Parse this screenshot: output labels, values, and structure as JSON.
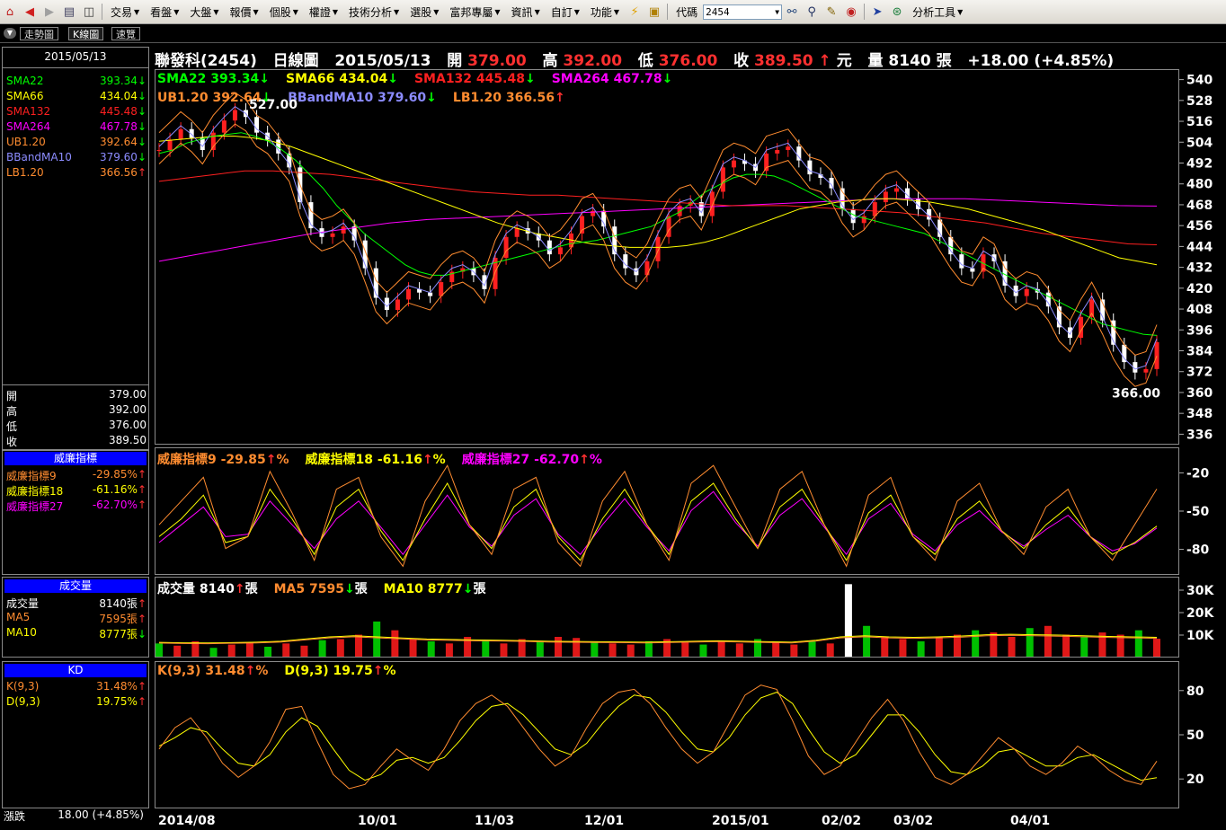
{
  "toolbar": {
    "menus": [
      "交易",
      "看盤",
      "大盤",
      "報價",
      "個股",
      "權證",
      "技術分析",
      "選股",
      "富邦專屬",
      "資訊",
      "自訂",
      "功能"
    ],
    "code_label": "代碼",
    "code_value": "2454",
    "analysis_tools": "分析工具"
  },
  "tabs": [
    "走勢圖",
    "K線圖",
    "速覽"
  ],
  "side": {
    "date": "2015/05/13",
    "indicators": [
      {
        "label": "SMA22",
        "value": "393.34",
        "dir": "down",
        "color": "#00ff00"
      },
      {
        "label": "SMA66",
        "value": "434.04",
        "dir": "down",
        "color": "#ffff00"
      },
      {
        "label": "SMA132",
        "value": "445.48",
        "dir": "down",
        "color": "#ff2020"
      },
      {
        "label": "SMA264",
        "value": "467.78",
        "dir": "down",
        "color": "#ff00ff"
      },
      {
        "label": "UB1.20",
        "value": "392.64",
        "dir": "down",
        "color": "#ff8c30"
      },
      {
        "label": "BBandMA10",
        "value": "379.60",
        "dir": "down",
        "color": "#8c8cff"
      },
      {
        "label": "LB1.20",
        "value": "366.56",
        "dir": "up",
        "color": "#ff8c30"
      }
    ],
    "ohlc": [
      {
        "label": "開",
        "value": "379.00"
      },
      {
        "label": "高",
        "value": "392.00"
      },
      {
        "label": "低",
        "value": "376.00"
      },
      {
        "label": "收",
        "value": "389.50"
      }
    ],
    "williams": {
      "title": "威廉指標",
      "rows": [
        {
          "label": "威廉指標9",
          "value": "-29.85%",
          "dir": "up",
          "color": "#ff8c30"
        },
        {
          "label": "威廉指標18",
          "value": "-61.16%",
          "dir": "up",
          "color": "#ffff00"
        },
        {
          "label": "威廉指標27",
          "value": "-62.70%",
          "dir": "up",
          "color": "#ff00ff"
        }
      ]
    },
    "volume": {
      "title": "成交量",
      "rows": [
        {
          "label": "成交量",
          "value": "8140張",
          "dir": "up",
          "color": "#ffffff"
        },
        {
          "label": "MA5",
          "value": "7595張",
          "dir": "up",
          "color": "#ff8c30"
        },
        {
          "label": "MA10",
          "value": "8777張",
          "dir": "down",
          "color": "#ffff00"
        }
      ]
    },
    "kd": {
      "title": "KD",
      "rows": [
        {
          "label": "K(9,3)",
          "value": "31.48%",
          "dir": "up",
          "color": "#ff8c30"
        },
        {
          "label": "D(9,3)",
          "value": "19.75%",
          "dir": "up",
          "color": "#ffff00"
        }
      ]
    },
    "change_label": "漲跌",
    "change_value": "18.00 (+4.85%)"
  },
  "header": {
    "stock": "聯發科(2454)",
    "chart_kind": "日線圖",
    "date": "2015/05/13",
    "open_label": "開",
    "open": "379.00",
    "high_label": "高",
    "high": "392.00",
    "low_label": "低",
    "low": "376.00",
    "close_label": "收",
    "close": "389.50",
    "unit": "元",
    "volume_label": "量",
    "volume": "8140",
    "volume_unit": "張",
    "change": "+18.00 (+4.85%)"
  },
  "price_legend": [
    {
      "label": "SMA22",
      "value": "393.34",
      "dir": "down",
      "color": "#00ff00"
    },
    {
      "label": "SMA66",
      "value": "434.04",
      "dir": "down",
      "color": "#ffff00"
    },
    {
      "label": "SMA132",
      "value": "445.48",
      "dir": "down",
      "color": "#ff2020"
    },
    {
      "label": "SMA264",
      "value": "467.78",
      "dir": "down",
      "color": "#ff00ff"
    }
  ],
  "band_legend": [
    {
      "label": "UB1.20",
      "value": "392.64",
      "dir": "down",
      "color": "#ff8c30"
    },
    {
      "label": "BBandMA10",
      "value": "379.60",
      "dir": "down",
      "color": "#8c8cff"
    },
    {
      "label": "LB1.20",
      "value": "366.56",
      "dir": "up",
      "color": "#ff8c30"
    }
  ],
  "williams_legend": [
    {
      "label": "威廉指標9",
      "value": "-29.85",
      "dir": "up",
      "unit": "%",
      "color": "#ff8c30"
    },
    {
      "label": "威廉指標18",
      "value": "-61.16",
      "dir": "up",
      "unit": "%",
      "color": "#ffff00"
    },
    {
      "label": "威廉指標27",
      "value": "-62.70",
      "dir": "up",
      "unit": "%",
      "color": "#ff00ff"
    }
  ],
  "volume_legend": [
    {
      "label": "成交量",
      "value": "8140",
      "dir": "up",
      "unit": "張",
      "color": "#ffffff"
    },
    {
      "label": "MA5",
      "value": "7595",
      "dir": "down",
      "unit": "張",
      "color": "#ff8c30"
    },
    {
      "label": "MA10",
      "value": "8777",
      "dir": "down",
      "unit": "張",
      "color": "#ffff00"
    }
  ],
  "kd_legend": [
    {
      "label": "K(9,3)",
      "value": "31.48",
      "dir": "up",
      "unit": "%",
      "color": "#ff8c30"
    },
    {
      "label": "D(9,3)",
      "value": "19.75",
      "dir": "up",
      "unit": "%",
      "color": "#ffff00"
    }
  ],
  "chart_data": {
    "type": "line",
    "price_axis": {
      "ticks": [
        540,
        528,
        516,
        504,
        492,
        480,
        468,
        456,
        444,
        432,
        420,
        408,
        396,
        384,
        372,
        360,
        348,
        336
      ],
      "ylim": [
        330,
        546
      ]
    },
    "williams_axis": {
      "ticks": [
        "-20",
        "-50",
        "-80"
      ],
      "ylim": [
        -100,
        0
      ]
    },
    "volume_axis": {
      "ticks": [
        "30K",
        "20K",
        "10K"
      ],
      "ylim": [
        0,
        36000
      ]
    },
    "kd_axis": {
      "ticks": [
        "80",
        "50",
        "20"
      ],
      "ylim": [
        0,
        100
      ]
    },
    "x_labels": [
      "2014/08",
      "10/01",
      "11/03",
      "12/01",
      "2015/01",
      "02/02",
      "03/02",
      "04/01"
    ],
    "annotations": [
      {
        "text": "527.00",
        "kind": "high"
      },
      {
        "text": "366.00",
        "kind": "low"
      }
    ],
    "close_path": [
      500,
      506,
      512,
      507,
      500,
      510,
      517,
      523,
      519,
      510,
      506,
      498,
      490,
      470,
      455,
      450,
      452,
      456,
      448,
      432,
      415,
      408,
      414,
      420,
      418,
      416,
      424,
      430,
      432,
      428,
      420,
      438,
      450,
      455,
      452,
      448,
      440,
      444,
      452,
      462,
      465,
      456,
      440,
      432,
      428,
      436,
      450,
      462,
      468,
      470,
      462,
      476,
      490,
      494,
      492,
      488,
      498,
      500,
      502,
      494,
      486,
      484,
      478,
      466,
      458,
      462,
      470,
      476,
      478,
      472,
      466,
      460,
      450,
      440,
      432,
      430,
      440,
      436,
      422,
      416,
      420,
      418,
      410,
      398,
      392,
      404,
      414,
      402,
      388,
      378,
      372,
      374,
      389.5
    ],
    "sma22_path": [
      498,
      500,
      504,
      506,
      508,
      509,
      510,
      508,
      505,
      500,
      494,
      486,
      478,
      468,
      460,
      452,
      446,
      440,
      434,
      430,
      428,
      428,
      430,
      432,
      434,
      436,
      438,
      440,
      442,
      444,
      446,
      447,
      448,
      450,
      452,
      454,
      456,
      460,
      464,
      470,
      476,
      480,
      484,
      486,
      486,
      485,
      482,
      478,
      474,
      470,
      466,
      462,
      460,
      458,
      456,
      454,
      452,
      448,
      444,
      440,
      436,
      432,
      428,
      424,
      420,
      416,
      412,
      408,
      404,
      400,
      398,
      396,
      394,
      393.34
    ],
    "sma66_path": [
      505,
      506,
      507,
      508,
      508,
      507,
      505,
      502,
      498,
      494,
      490,
      486,
      482,
      478,
      474,
      470,
      466,
      462,
      458,
      455,
      452,
      450,
      448,
      446,
      445,
      444,
      444,
      444,
      445,
      447,
      450,
      454,
      458,
      462,
      466,
      468,
      470,
      471,
      472,
      472,
      471,
      470,
      468,
      466,
      463,
      460,
      457,
      454,
      450,
      446,
      442,
      438,
      436,
      434.04
    ],
    "sma132_path": [
      482,
      484,
      486,
      488,
      488,
      487,
      486,
      484,
      482,
      480,
      478,
      476,
      475,
      474,
      474,
      473,
      472,
      471,
      470,
      469,
      468,
      468,
      468,
      467,
      466,
      465,
      464,
      462,
      460,
      458,
      455,
      452,
      450,
      448,
      446,
      445.48
    ],
    "sma264_path": [
      436,
      440,
      444,
      448,
      452,
      455,
      458,
      460,
      461,
      462,
      463,
      464,
      465,
      466,
      467,
      468,
      469,
      470,
      471,
      472,
      472,
      472,
      471,
      470,
      469,
      468,
      467.78
    ],
    "williams9_path": [
      -60,
      -40,
      -20,
      -80,
      -70,
      -15,
      -50,
      -90,
      -30,
      -20,
      -70,
      -95,
      -40,
      -10,
      -60,
      -85,
      -30,
      -20,
      -75,
      -95,
      -40,
      -15,
      -60,
      -90,
      -25,
      -10,
      -45,
      -80,
      -30,
      -15,
      -60,
      -95,
      -35,
      -20,
      -70,
      -90,
      -40,
      -25,
      -65,
      -85,
      -45,
      -30,
      -70,
      -90,
      -60,
      -29.85
    ],
    "williams18_path": [
      -70,
      -55,
      -35,
      -75,
      -70,
      -30,
      -55,
      -85,
      -45,
      -30,
      -65,
      -90,
      -55,
      -25,
      -60,
      -80,
      -45,
      -30,
      -70,
      -90,
      -55,
      -30,
      -60,
      -85,
      -40,
      -25,
      -55,
      -80,
      -45,
      -30,
      -60,
      -90,
      -50,
      -35,
      -70,
      -85,
      -55,
      -40,
      -65,
      -80,
      -60,
      -45,
      -70,
      -85,
      -75,
      -61.16
    ],
    "williams27_path": [
      -75,
      -60,
      -45,
      -70,
      -68,
      -40,
      -60,
      -80,
      -55,
      -40,
      -62,
      -85,
      -60,
      -35,
      -62,
      -78,
      -52,
      -38,
      -68,
      -85,
      -60,
      -38,
      -62,
      -82,
      -48,
      -32,
      -58,
      -78,
      -52,
      -38,
      -62,
      -85,
      -55,
      -42,
      -68,
      -82,
      -60,
      -48,
      -66,
      -78,
      -64,
      -52,
      -70,
      -82,
      -76,
      -62.7
    ],
    "volume_values": [
      6000,
      5000,
      7000,
      4000,
      5500,
      6500,
      4500,
      6000,
      5000,
      7500,
      8000,
      10000,
      16000,
      12000,
      8000,
      7000,
      6000,
      9000,
      7000,
      6000,
      8000,
      7000,
      9000,
      8500,
      6500,
      6000,
      5500,
      7000,
      8000,
      6500,
      5500,
      7000,
      6000,
      8000,
      6500,
      5500,
      7000,
      6000,
      33000,
      14000,
      9000,
      8000,
      7000,
      9000,
      10000,
      12000,
      11000,
      9000,
      13000,
      14000,
      10000,
      9000,
      11000,
      10000,
      12000,
      8140
    ],
    "volume_ma10_path": [
      6500,
      6300,
      6200,
      6400,
      6600,
      7000,
      8000,
      9000,
      9500,
      9000,
      8500,
      8000,
      7800,
      7600,
      7500,
      7300,
      7000,
      6900,
      6800,
      6700,
      6600,
      6800,
      7000,
      7200,
      7000,
      6800,
      6600,
      7500,
      9000,
      9500,
      9000,
      8800,
      9000,
      9400,
      10000,
      10200,
      10000,
      9800,
      9500,
      9200,
      9000,
      8777
    ],
    "k_path": [
      40,
      55,
      62,
      48,
      30,
      20,
      28,
      45,
      68,
      70,
      45,
      22,
      12,
      15,
      28,
      40,
      32,
      25,
      40,
      60,
      72,
      78,
      70,
      55,
      40,
      28,
      35,
      55,
      72,
      80,
      82,
      72,
      55,
      40,
      30,
      38,
      58,
      78,
      85,
      82,
      60,
      35,
      22,
      28,
      45,
      62,
      75,
      60,
      38,
      20,
      15,
      22,
      35,
      48,
      40,
      28,
      22,
      30,
      42,
      35,
      25,
      18,
      15,
      31.48
    ],
    "d_path": [
      42,
      48,
      55,
      52,
      40,
      30,
      28,
      36,
      52,
      62,
      56,
      40,
      25,
      18,
      22,
      32,
      34,
      30,
      34,
      46,
      60,
      70,
      72,
      64,
      52,
      40,
      36,
      44,
      58,
      70,
      78,
      76,
      66,
      52,
      40,
      38,
      48,
      64,
      76,
      80,
      72,
      54,
      38,
      30,
      36,
      50,
      64,
      64,
      52,
      36,
      24,
      22,
      28,
      38,
      40,
      34,
      28,
      28,
      34,
      36,
      30,
      24,
      18,
      19.75
    ]
  }
}
